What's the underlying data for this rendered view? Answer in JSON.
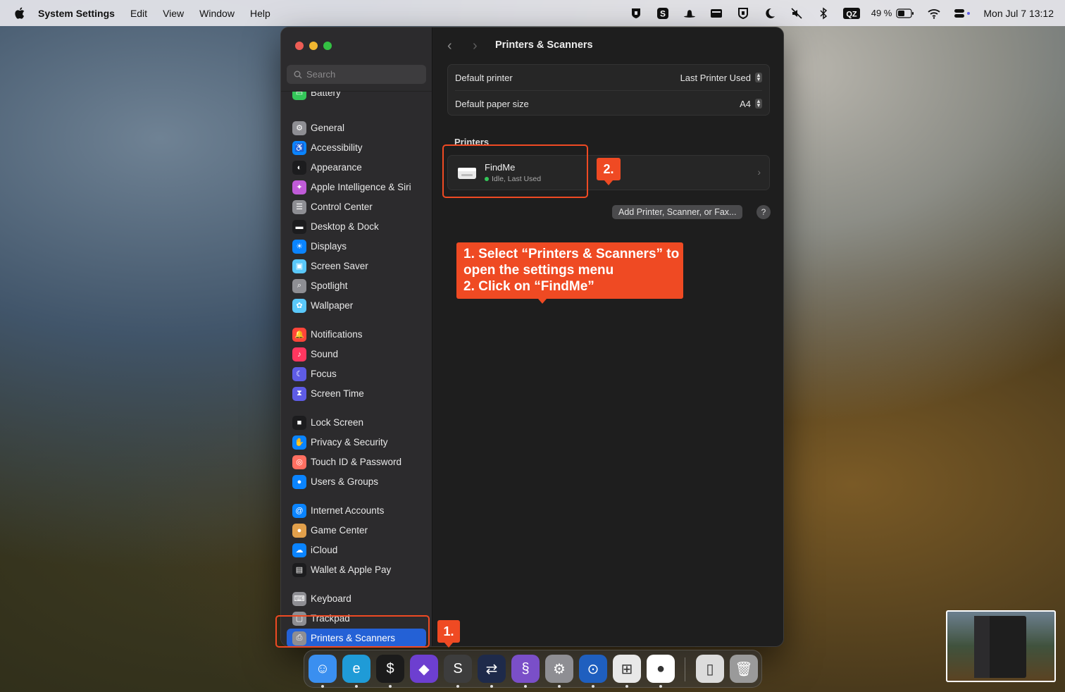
{
  "menubar": {
    "app_name": "System Settings",
    "menus": [
      "Edit",
      "View",
      "Window",
      "Help"
    ],
    "battery_percent": "49 %",
    "input_source": "QZ",
    "clock": "Mon Jul 7  13:12"
  },
  "sidebar": {
    "search_placeholder": "Search",
    "items": [
      {
        "label": "Battery",
        "icon": "battery-icon",
        "color": "#34c759"
      },
      {
        "label": "General",
        "icon": "gear-icon",
        "color": "#8e8e93"
      },
      {
        "label": "Accessibility",
        "icon": "accessibility-icon",
        "color": "#0a84ff"
      },
      {
        "label": "Appearance",
        "icon": "appearance-icon",
        "color": "#1c1c1e"
      },
      {
        "label": "Apple Intelligence & Siri",
        "icon": "siri-icon",
        "color": "#c05bd8"
      },
      {
        "label": "Control Center",
        "icon": "control-center-icon",
        "color": "#8e8e93"
      },
      {
        "label": "Desktop & Dock",
        "icon": "dock-icon",
        "color": "#1c1c1e"
      },
      {
        "label": "Displays",
        "icon": "sun-icon",
        "color": "#0a84ff"
      },
      {
        "label": "Screen Saver",
        "icon": "screen-saver-icon",
        "color": "#5ac8fa"
      },
      {
        "label": "Spotlight",
        "icon": "magnifier-icon",
        "color": "#8e8e93"
      },
      {
        "label": "Wallpaper",
        "icon": "flower-icon",
        "color": "#5ac8fa"
      },
      {
        "label": "Notifications",
        "icon": "bell-icon",
        "color": "#ff453a"
      },
      {
        "label": "Sound",
        "icon": "speaker-icon",
        "color": "#ff375f"
      },
      {
        "label": "Focus",
        "icon": "moon-icon",
        "color": "#5e5ce6"
      },
      {
        "label": "Screen Time",
        "icon": "hourglass-icon",
        "color": "#5e5ce6"
      },
      {
        "label": "Lock Screen",
        "icon": "lock-icon",
        "color": "#1c1c1e"
      },
      {
        "label": "Privacy & Security",
        "icon": "hand-icon",
        "color": "#0a84ff"
      },
      {
        "label": "Touch ID & Password",
        "icon": "fingerprint-icon",
        "color": "#ff6f61"
      },
      {
        "label": "Users & Groups",
        "icon": "users-icon",
        "color": "#0a84ff"
      },
      {
        "label": "Internet Accounts",
        "icon": "at-icon",
        "color": "#0a84ff"
      },
      {
        "label": "Game Center",
        "icon": "game-center-icon",
        "color": "#e2a04b"
      },
      {
        "label": "iCloud",
        "icon": "cloud-icon",
        "color": "#0a84ff"
      },
      {
        "label": "Wallet & Apple Pay",
        "icon": "wallet-icon",
        "color": "#1c1c1e"
      },
      {
        "label": "Keyboard",
        "icon": "keyboard-icon",
        "color": "#8e8e93"
      },
      {
        "label": "Trackpad",
        "icon": "trackpad-icon",
        "color": "#8e8e93"
      },
      {
        "label": "Printers & Scanners",
        "icon": "printer-icon",
        "color": "#8e8e93",
        "selected": true
      }
    ]
  },
  "main": {
    "title": "Printers & Scanners",
    "default_printer_label": "Default printer",
    "default_printer_value": "Last Printer Used",
    "paper_size_label": "Default paper size",
    "paper_size_value": "A4",
    "printers_heading": "Printers",
    "printer": {
      "name": "FindMe",
      "status": "Idle, Last Used"
    },
    "add_button": "Add Printer, Scanner, or Fax...",
    "help_button": "?"
  },
  "annotations": {
    "step1_badge": "1.",
    "step2_badge": "2.",
    "callout_lines": [
      "1. Select “Printers & Scanners” to",
      "open the settings menu",
      "2. Click on “FindMe”"
    ],
    "accent": "#ef4a23"
  },
  "dock": {
    "apps": [
      "Finder",
      "Microsoft Edge",
      "Terminal",
      "Obsidian",
      "Sublime Text",
      "TeamViewer",
      "Screen Recorder",
      "System Settings",
      "Bitwarden",
      "Windows App",
      "Google Chrome",
      "Document",
      "Trash"
    ]
  }
}
